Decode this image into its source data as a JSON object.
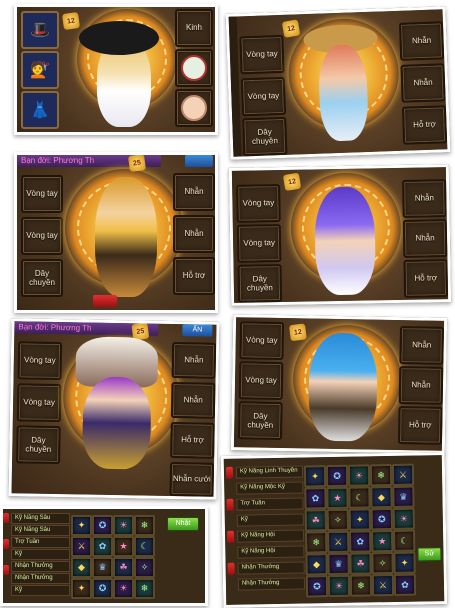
{
  "panel1": {
    "level": "12",
    "kinh_label": "Kinh",
    "left_icons": [
      "hat-icon",
      "hair-icon",
      "dress-icon"
    ],
    "right_icons": [
      "frame-icon",
      "face-icon"
    ]
  },
  "panel2": {
    "level": "12",
    "left_slots": [
      "Vòng tay",
      "Vòng tay",
      "Dây\nchuyền"
    ],
    "right_slots": [
      "Nhẫn",
      "Nhẫn",
      "Hỗ trợ"
    ]
  },
  "panel3": {
    "spouse": "Bạn đời: Phương Th",
    "level": "25",
    "left_slots": [
      "Vòng tay",
      "Vòng tay",
      "Dây\nchuyền"
    ],
    "right_slots": [
      "Nhẫn",
      "Nhẫn",
      "Hỗ trợ"
    ]
  },
  "panel4": {
    "level": "12",
    "left_slots": [
      "Vòng tay",
      "Vòng tay",
      "Dây\nchuyền"
    ],
    "right_slots": [
      "Nhẫn",
      "Nhẫn",
      "Hỗ trợ"
    ]
  },
  "panel5": {
    "spouse": "Bạn đời: Phương Th",
    "level": "25",
    "tab": "ẨN",
    "left_slots": [
      "Vòng tay",
      "Vòng tay",
      "Dây\nchuyền"
    ],
    "right_slots": [
      "Nhẫn",
      "Nhẫn",
      "Hỗ trợ",
      "Nhẫn cưới"
    ]
  },
  "panel6": {
    "level": "12",
    "left_slots": [
      "Vòng tay",
      "Vòng tay",
      "Dây\nchuyền"
    ],
    "right_slots": [
      "Nhẫn",
      "Nhẫn",
      "Hỗ trợ"
    ]
  },
  "panel7": {
    "list": [
      "Kỹ Năng Sâu",
      "Kỹ Năng Sâu",
      "Trợ Tuần",
      "Kỹ",
      "Nhận Thưởng",
      "Nhận Thưởng",
      "Kỹ"
    ],
    "button": "Nhặt"
  },
  "panel8": {
    "list": [
      "Kỹ Năng Linh Thuyền",
      "Kỹ Năng Mộc Kỹ",
      "Trợ Tuần",
      "Kỹ",
      "Kỹ Năng Hội",
      "Kỹ Năng Hội",
      "Nhận Thưởng",
      "Nhận Thưởng"
    ],
    "button": "Sử"
  },
  "colors": {
    "slot_bg": "#3a2a1a",
    "halo": "#f0b43a",
    "panel_bg": "#4a3420"
  }
}
